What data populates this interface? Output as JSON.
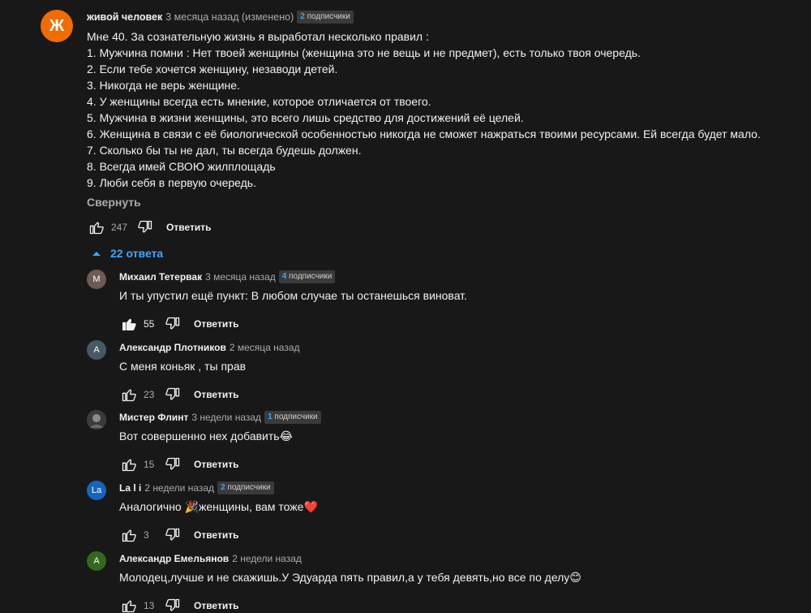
{
  "main_comment": {
    "avatar_letter": "Ж",
    "avatar_color": "#ef6c00",
    "author": "живой человек",
    "meta": "3 месяца назад (изменено)",
    "badge_num": "2",
    "badge_text": "подписчики",
    "lines": [
      "Мне 40. За сознательную жизнь я выработал несколько правил :",
      "1. Мужчина помни : Нет твоей женщины (женщина это не вещь и не предмет), есть только твоя очередь.",
      "2. Если тебе хочется женщину, незаводи детей.",
      "3. Никогда не верь женщине.",
      "4. У женщины всегда есть мнение, которое отличается от твоего.",
      "5. Мужчина в жизни женщины, это всего лишь средство для достижений её целей.",
      "6. Женщина в связи с её биологической особенностью никогда не сможет нажраться твоими ресурсами. Ей всегда будет мало.",
      "7. Сколько бы ты не дал, ты всегда будешь должен.",
      "8. Всегда имей СВОЮ жилплощадь",
      "9. Люби себя в первую очередь."
    ],
    "collapse_label": "Свернуть",
    "likes": "247",
    "reply_label": "Ответить"
  },
  "replies_toggle": {
    "label": "22 ответа"
  },
  "replies": [
    {
      "avatar_letter": "М",
      "avatar_color": "#6d5a55",
      "author": "Михаил Тетервак",
      "meta": "3 месяца назад",
      "badge_num": "4",
      "badge_text": "подписчики",
      "text": "И ты упустил ещё пункт: В любом случае ты останешься виноват.",
      "likes": "55",
      "liked": true,
      "reply_label": "Ответить"
    },
    {
      "avatar_letter": "А",
      "avatar_color": "#455a64",
      "author": "Александр Плотников",
      "meta": "2 месяца назад",
      "badge_num": "",
      "badge_text": "",
      "text": "С меня коньяк , ты прав",
      "likes": "23",
      "liked": false,
      "reply_label": "Ответить"
    },
    {
      "avatar_letter": "",
      "avatar_color": "#5a5a5a",
      "author": "Мистер Флинт",
      "meta": "3 недели назад",
      "badge_num": "1",
      "badge_text": "подписчики",
      "text": "Вот совершенно нех добавить😂",
      "likes": "15",
      "liked": false,
      "reply_label": "Ответить"
    },
    {
      "avatar_letter": "La",
      "avatar_color": "#1565c0",
      "author": "La l i",
      "meta": "2 недели назад",
      "badge_num": "2",
      "badge_text": "подписчики",
      "text": "Аналогично 🎉женщины, вам тоже❤️",
      "likes": "3",
      "liked": false,
      "reply_label": "Ответить"
    },
    {
      "avatar_letter": "А",
      "avatar_color": "#33691e",
      "author": "Александр Емельянов",
      "meta": "2 недели назад",
      "badge_num": "",
      "badge_text": "",
      "text": "Молодец,лучше и не скажишь.У Эдуарда пять правил,а у тебя девять,но все по делу😊",
      "likes": "13",
      "liked": false,
      "reply_label": "Ответить"
    }
  ]
}
